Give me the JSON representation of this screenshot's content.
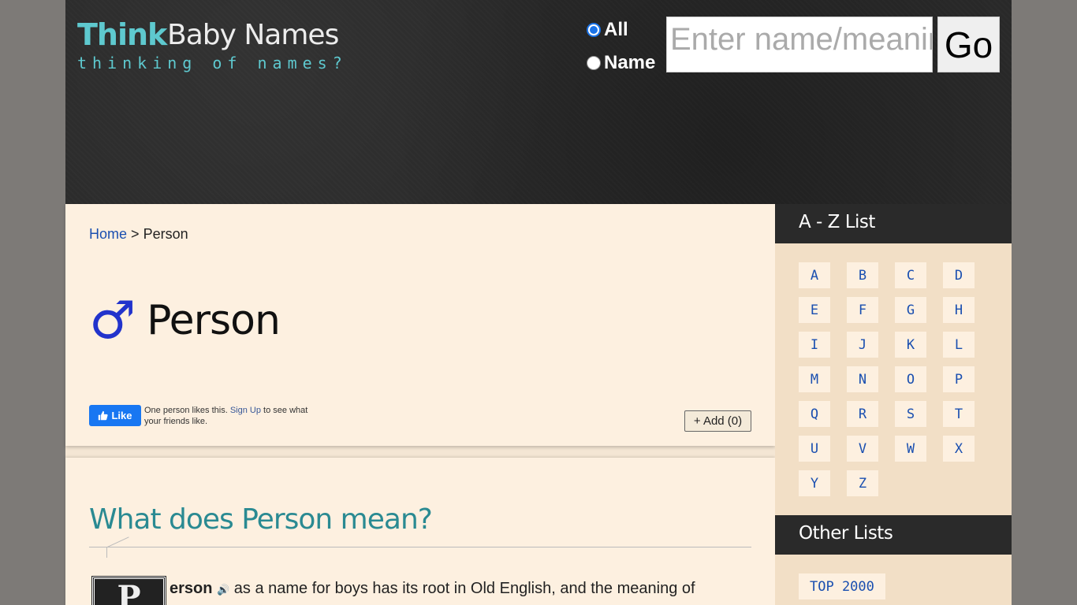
{
  "header": {
    "logo_think": "Think",
    "logo_rest": "Baby Names",
    "tagline": "thinking of names?",
    "search": {
      "radio_all_label": "All",
      "radio_name_label": "Name",
      "selected": "All",
      "placeholder": "Enter name/meaning",
      "go_label": "Go"
    }
  },
  "breadcrumb": {
    "home": "Home",
    "separator": ">",
    "current": "Person"
  },
  "name": {
    "gender_symbol": "♂",
    "title": "Person"
  },
  "facebook": {
    "like_label": "Like",
    "text_prefix": "One person likes this.",
    "signup": "Sign Up",
    "text_suffix": "to see what your friends like."
  },
  "add_button": "+ Add (0)",
  "meaning": {
    "heading": "What does Person mean?",
    "dropcap": "P",
    "name_rest": "erson",
    "speaker_icon": "🔊",
    "text": "as a name for boys has its root in Old English, and the meaning of"
  },
  "sidebar": {
    "az_title": "A - Z List",
    "letters": [
      "A",
      "B",
      "C",
      "D",
      "E",
      "F",
      "G",
      "H",
      "I",
      "J",
      "K",
      "L",
      "M",
      "N",
      "O",
      "P",
      "Q",
      "R",
      "S",
      "T",
      "U",
      "V",
      "W",
      "X",
      "Y",
      "Z"
    ],
    "other_title": "Other Lists",
    "other_items": [
      "TOP 2000"
    ]
  },
  "colors": {
    "accent_teal": "#5ec9cf",
    "heading_teal": "#2a8a92",
    "link_blue": "#1a4fb0",
    "header_bg": "#2a2a2a",
    "card_bg": "#fdf0e0",
    "sidebar_bg": "#f2dfc6",
    "male_blue": "#2233cc"
  }
}
